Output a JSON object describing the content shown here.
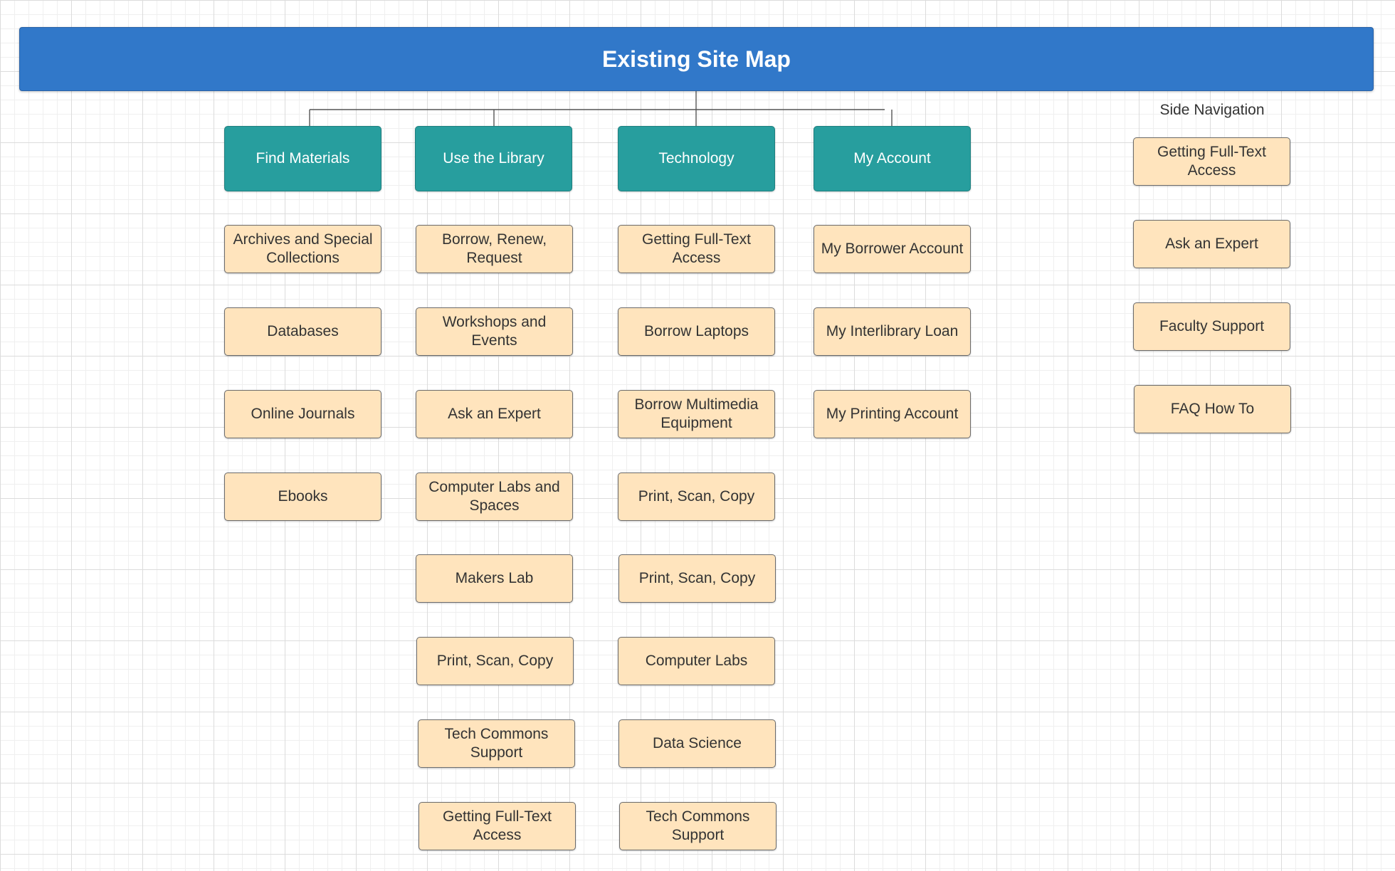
{
  "title": "Existing Site Map",
  "colors": {
    "title_bar": "#3178c9",
    "section_box": "#279e9e",
    "page_box": "#ffe4bd",
    "page_border": "#6b6b6b"
  },
  "sections": [
    {
      "label": "Find Materials",
      "pages": [
        "Archives and Special Collections",
        "Databases",
        "Online Journals",
        "Ebooks"
      ]
    },
    {
      "label": "Use the Library",
      "pages": [
        "Borrow, Renew, Request",
        "Workshops and Events",
        "Ask an Expert",
        "Computer Labs and Spaces",
        "Makers Lab",
        "Print, Scan, Copy",
        "Tech Commons Support",
        "Getting Full-Text Access"
      ]
    },
    {
      "label": "Technology",
      "pages": [
        "Getting Full-Text Access",
        "Borrow Laptops",
        "Borrow Multimedia Equipment",
        "Print, Scan, Copy",
        "Print, Scan, Copy",
        "Computer Labs",
        "Data Science",
        "Tech Commons Support"
      ]
    },
    {
      "label": "My Account",
      "pages": [
        "My Borrower Account",
        "My Interlibrary Loan",
        "My Printing Account"
      ]
    }
  ],
  "side_navigation": {
    "label": "Side Navigation",
    "items": [
      "Getting Full-Text Access",
      "Ask an Expert",
      "Faculty Support",
      "FAQ How To"
    ]
  }
}
